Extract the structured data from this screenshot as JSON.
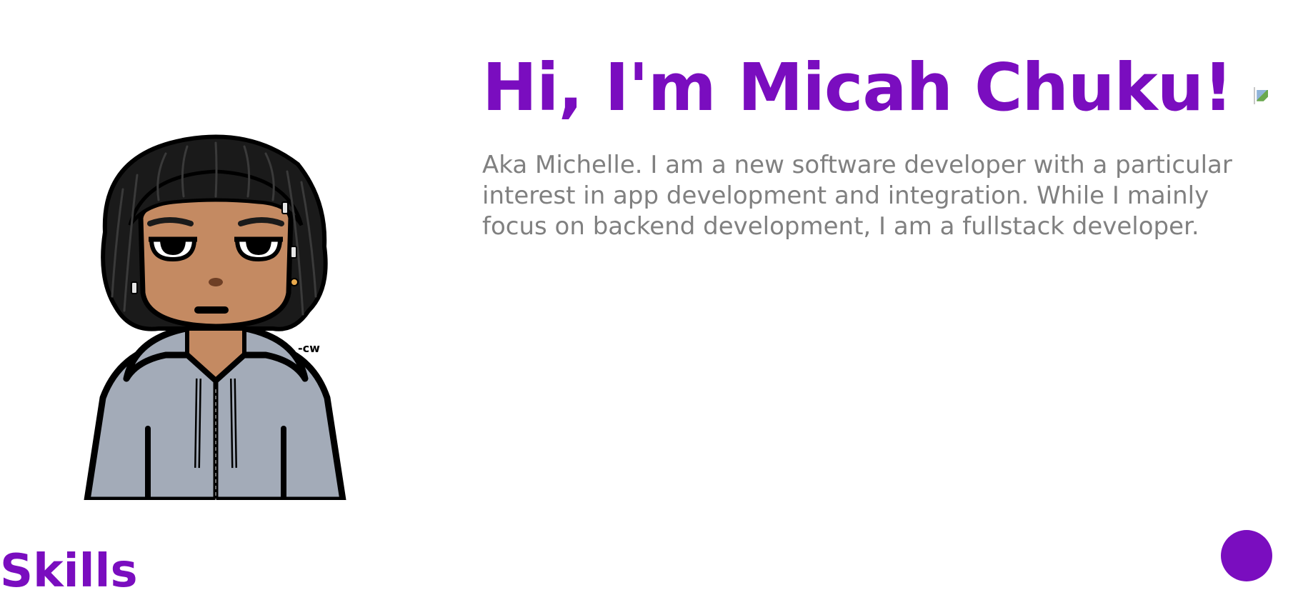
{
  "hero": {
    "avatar_alt": "cartoon avatar illustration",
    "title": "Hi, I'm Micah Chuku!",
    "title_icon": "broken-image-icon",
    "bio": "Aka Michelle. I am a new software developer with a particular interest in app development and integration. While I mainly focus on backend development, I am a fullstack developer."
  },
  "skills": {
    "title": "Skills"
  },
  "fab": {
    "icon": "purple-circle-button"
  },
  "colors": {
    "accent": "#7a0dbf",
    "body_text": "#808080",
    "background": "#ffffff",
    "hoodie": "#a3abb8",
    "skin": "#c48a62",
    "hair": "#1a1a1a"
  }
}
